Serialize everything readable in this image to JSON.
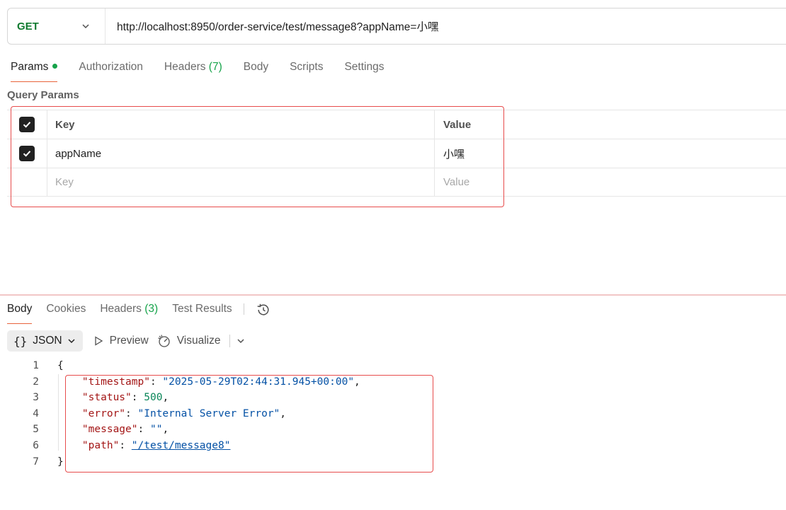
{
  "request": {
    "method": "GET",
    "url": "http://localhost:8950/order-service/test/message8?appName=小嘿"
  },
  "request_tabs": [
    {
      "label": "Params",
      "active": true,
      "dot": true
    },
    {
      "label": "Authorization"
    },
    {
      "label": "Headers",
      "count": "(7)"
    },
    {
      "label": "Body"
    },
    {
      "label": "Scripts"
    },
    {
      "label": "Settings"
    }
  ],
  "query_params": {
    "title": "Query Params",
    "header": {
      "key": "Key",
      "value": "Value"
    },
    "rows": [
      {
        "key": "appName",
        "value": "小嘿",
        "checked": true
      }
    ],
    "placeholder": {
      "key": "Key",
      "value": "Value"
    }
  },
  "response_tabs": [
    {
      "label": "Body",
      "active": true
    },
    {
      "label": "Cookies"
    },
    {
      "label": "Headers",
      "count": "(3)"
    },
    {
      "label": "Test Results"
    }
  ],
  "toolbar": {
    "format_label": "JSON",
    "preview_label": "Preview",
    "visualize_label": "Visualize"
  },
  "response_body": {
    "line_numbers": [
      "1",
      "2",
      "3",
      "4",
      "5",
      "6",
      "7"
    ],
    "open_brace": "{",
    "close_brace": "}",
    "fields": [
      {
        "key": "\"timestamp\"",
        "value": "\"2025-05-29T02:44:31.945+00:00\"",
        "type": "string",
        "comma": ","
      },
      {
        "key": "\"status\"",
        "value": "500",
        "type": "number",
        "comma": ","
      },
      {
        "key": "\"error\"",
        "value": "\"Internal Server Error\"",
        "type": "string",
        "comma": ","
      },
      {
        "key": "\"message\"",
        "value": "\"\"",
        "type": "string",
        "comma": ","
      },
      {
        "key": "\"path\"",
        "value": "\"/test/message8\"",
        "type": "link",
        "comma": ""
      }
    ]
  },
  "colors": {
    "accent": "#e8643c",
    "highlight_box": "#e74c4c",
    "method": "#0f7a2f",
    "json_key": "#a31515",
    "json_string": "#0451a5",
    "json_number": "#098658"
  }
}
